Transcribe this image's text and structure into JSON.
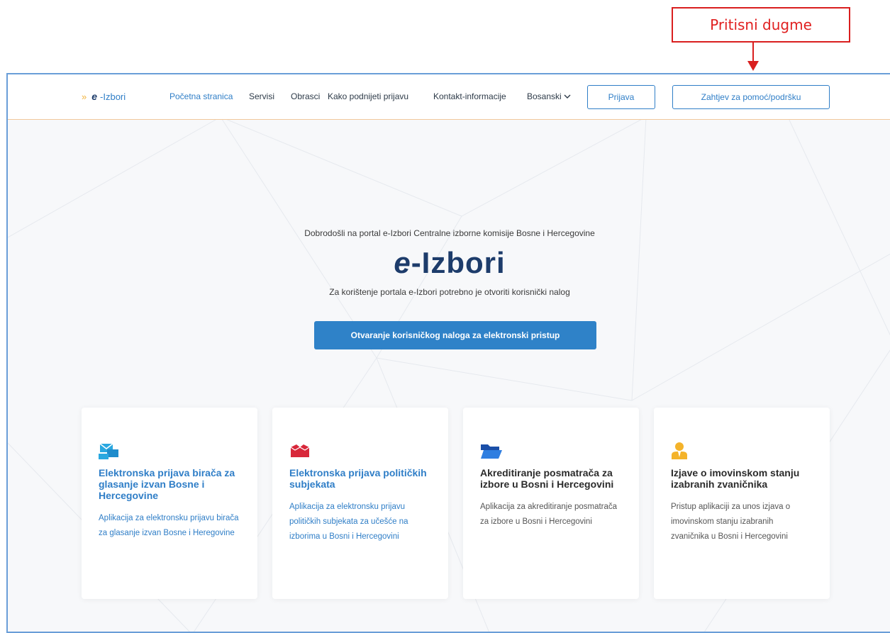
{
  "annotation": {
    "label": "Pritisni dugme"
  },
  "nav": {
    "brand_prefix": "e",
    "brand_suffix": "-Izbori",
    "links": [
      "Početna stranica",
      "Servisi",
      "Obrasci",
      "Kako podnijeti prijavu",
      "Kontakt-informacije"
    ],
    "language": "Bosanski",
    "login_label": "Prijava",
    "help_label": "Zahtjev za pomoć/podršku"
  },
  "hero": {
    "welcome": "Dobrodošli na portal e-Izbori Centralne izborne komisije Bosne i Hercegovine",
    "logo_e": "e",
    "logo_rest": "-Izbori",
    "subtitle": "Za korištenje portala e-Izbori potrebno je otvoriti korisnički nalog",
    "cta_label": "Otvaranje korisničkog naloga za elektronski pristup"
  },
  "cards": [
    {
      "icon": "envelope-icon",
      "title": "Elektronska prijava birača za glasanje izvan Bosne i Hercegovine",
      "desc": "Aplikacija za elektronsku prijavu birača za glasanje izvan Bosne i Heregovine"
    },
    {
      "icon": "box-icon",
      "title": "Elektronska prijava političkih subjekata",
      "desc": "Aplikacija za elektronsku prijavu političkih subjekata za učešće na izborima u Bosni i Hercegovini"
    },
    {
      "icon": "folder-icon",
      "title": "Akreditiranje posmatrača za izbore u Bosni i Hercegovini",
      "desc": "Aplikacija za akreditiranje posmatrača za izbore u Bosni i Hercegovini"
    },
    {
      "icon": "person-icon",
      "title": "Izjave o imovinskom stanju izabranih zvaničnika",
      "desc": "Pristup aplikaciji za unos izjava o imovinskom stanju izabranih zvaničnika u Bosni i Hercegovini"
    }
  ],
  "colors": {
    "accent": "#2f7ec7",
    "annotation": "#d91f1f",
    "brand_dark": "#1d3c6b"
  }
}
